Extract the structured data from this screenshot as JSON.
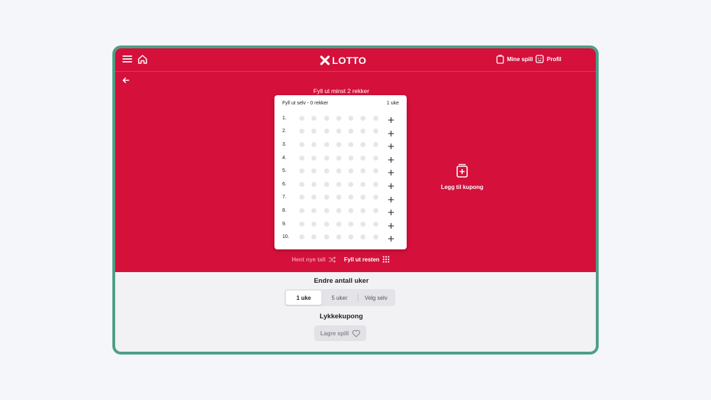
{
  "header": {
    "logo_text": "LOTTO",
    "my_games_label": "Mine spill",
    "profile_label": "Profil"
  },
  "instruction": "Fyll ut minst 2 rekker",
  "card": {
    "title": "Fyll ut selv - 0 rekker",
    "weeks": "1 uke",
    "rows": [
      "1.",
      "2.",
      "3.",
      "4.",
      "5.",
      "6.",
      "7.",
      "8.",
      "9.",
      "10."
    ],
    "dots_per_row": 7
  },
  "actions": {
    "new_numbers": "Hent nye tall",
    "fill_rest": "Fyll ut resten"
  },
  "add_coupon_label": "Legg til kupong",
  "weeks_section": {
    "title": "Endre antall uker",
    "options": [
      "1 uke",
      "5 uker",
      "Velg selv"
    ],
    "selected": "1 uke"
  },
  "lucky_section": {
    "title": "Lykkekupong",
    "save_label": "Lagre spill"
  },
  "colors": {
    "brand_red": "#d4103b",
    "frame_green": "#4e9f86"
  }
}
